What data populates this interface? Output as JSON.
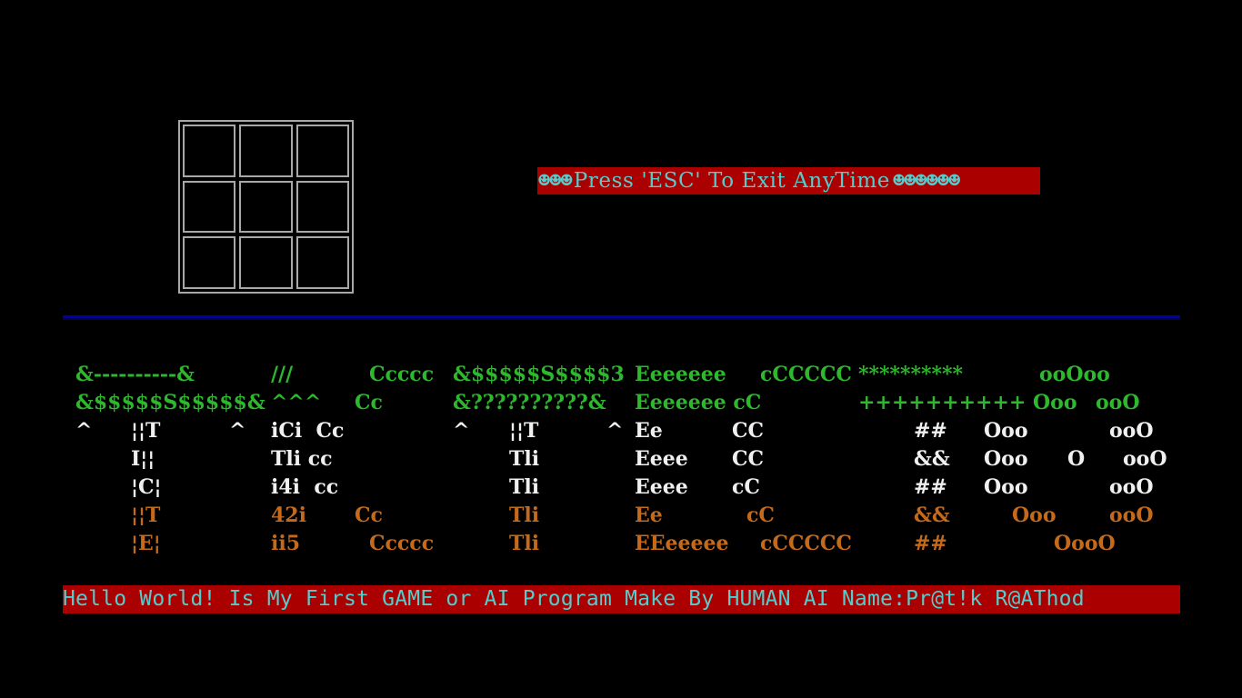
{
  "esc_banner": {
    "prefix_smileys": "☻☻☻",
    "text": "Press 'ESC' To Exit AnyTime",
    "suffix_smileys": "☻☻☻☻☻☻"
  },
  "board": {
    "cells": [
      "",
      "",
      "",
      "",
      "",
      "",
      "",
      "",
      ""
    ]
  },
  "art": {
    "rows": [
      {
        "segments": [
          {
            "text": "&----------&",
            "color": "green"
          },
          {
            "text": "///",
            "color": "green"
          },
          {
            "text": "Ccccc",
            "color": "green"
          },
          {
            "text": "&$$$$$S$$$$3",
            "color": "green"
          },
          {
            "text": "Eeeeeee",
            "color": "green"
          },
          {
            "text": "cCCCCC",
            "color": "green"
          },
          {
            "text": "**********",
            "color": "green"
          },
          {
            "text": "ooOoo",
            "color": "green"
          }
        ]
      },
      {
        "segments": [
          {
            "text": "&$$$$$S$$$$$&",
            "color": "green"
          },
          {
            "text": "^^^",
            "color": "green"
          },
          {
            "text": "Cc",
            "color": "green"
          },
          {
            "text": "&??????????&",
            "color": "green"
          },
          {
            "text": "Eeeeeee cC",
            "color": "green"
          },
          {
            "text": "++++++++++ Ooo",
            "color": "green"
          },
          {
            "text": "ooO",
            "color": "green"
          }
        ]
      },
      {
        "segments": [
          {
            "text": "^",
            "color": "white"
          },
          {
            "text": "¦¦T",
            "color": "white"
          },
          {
            "text": "^",
            "color": "white"
          },
          {
            "text": "iCi  Cc",
            "color": "white"
          },
          {
            "text": "^",
            "color": "white"
          },
          {
            "text": "¦¦T",
            "color": "white"
          },
          {
            "text": "^",
            "color": "white"
          },
          {
            "text": "Ee",
            "color": "white"
          },
          {
            "text": "CC",
            "color": "white"
          },
          {
            "text": "##",
            "color": "white"
          },
          {
            "text": "Ooo",
            "color": "white"
          },
          {
            "text": "ooO",
            "color": "white"
          }
        ]
      },
      {
        "segments": [
          {
            "text": "I¦¦",
            "color": "white"
          },
          {
            "text": "Tli cc",
            "color": "white"
          },
          {
            "text": "Tli",
            "color": "white"
          },
          {
            "text": "Eeee",
            "color": "white"
          },
          {
            "text": "CC",
            "color": "white"
          },
          {
            "text": "&&",
            "color": "white"
          },
          {
            "text": "Ooo",
            "color": "white"
          },
          {
            "text": "O",
            "color": "white"
          },
          {
            "text": "ooO",
            "color": "white"
          }
        ]
      },
      {
        "segments": [
          {
            "text": "¦C¦",
            "color": "white"
          },
          {
            "text": "i4i  cc",
            "color": "white"
          },
          {
            "text": "Tli",
            "color": "white"
          },
          {
            "text": "Eeee",
            "color": "white"
          },
          {
            "text": "cC",
            "color": "white"
          },
          {
            "text": "##",
            "color": "white"
          },
          {
            "text": "Ooo",
            "color": "white"
          },
          {
            "text": "ooO",
            "color": "white"
          }
        ]
      },
      {
        "segments": [
          {
            "text": "¦¦T",
            "color": "orange"
          },
          {
            "text": "42i",
            "color": "orange"
          },
          {
            "text": "Cc",
            "color": "orange"
          },
          {
            "text": "Tli",
            "color": "orange"
          },
          {
            "text": "Ee",
            "color": "orange"
          },
          {
            "text": "cC",
            "color": "orange"
          },
          {
            "text": "&&",
            "color": "orange"
          },
          {
            "text": "Ooo",
            "color": "orange"
          },
          {
            "text": "ooO",
            "color": "orange"
          }
        ]
      },
      {
        "segments": [
          {
            "text": "¦E¦",
            "color": "orange"
          },
          {
            "text": "ii5",
            "color": "orange"
          },
          {
            "text": "Ccccc",
            "color": "orange"
          },
          {
            "text": "Tli",
            "color": "orange"
          },
          {
            "text": "EEeeeee",
            "color": "orange"
          },
          {
            "text": "cCCCCC",
            "color": "orange"
          },
          {
            "text": "##",
            "color": "orange"
          },
          {
            "text": "OooO",
            "color": "orange"
          }
        ]
      }
    ]
  },
  "footer_banner": {
    "text": "Hello World! Is My First GAME or AI Program Make By HUMAN AI Name:Pr@t!k R@AThod"
  },
  "colors": {
    "background": "#000000",
    "banner_bg": "#aa0000",
    "banner_text": "#55cccc",
    "divider": "#0000aa",
    "board_lines": "#a8a8a8",
    "green": "#2db82d",
    "white": "#f0f0f0",
    "orange": "#c46a1a"
  }
}
